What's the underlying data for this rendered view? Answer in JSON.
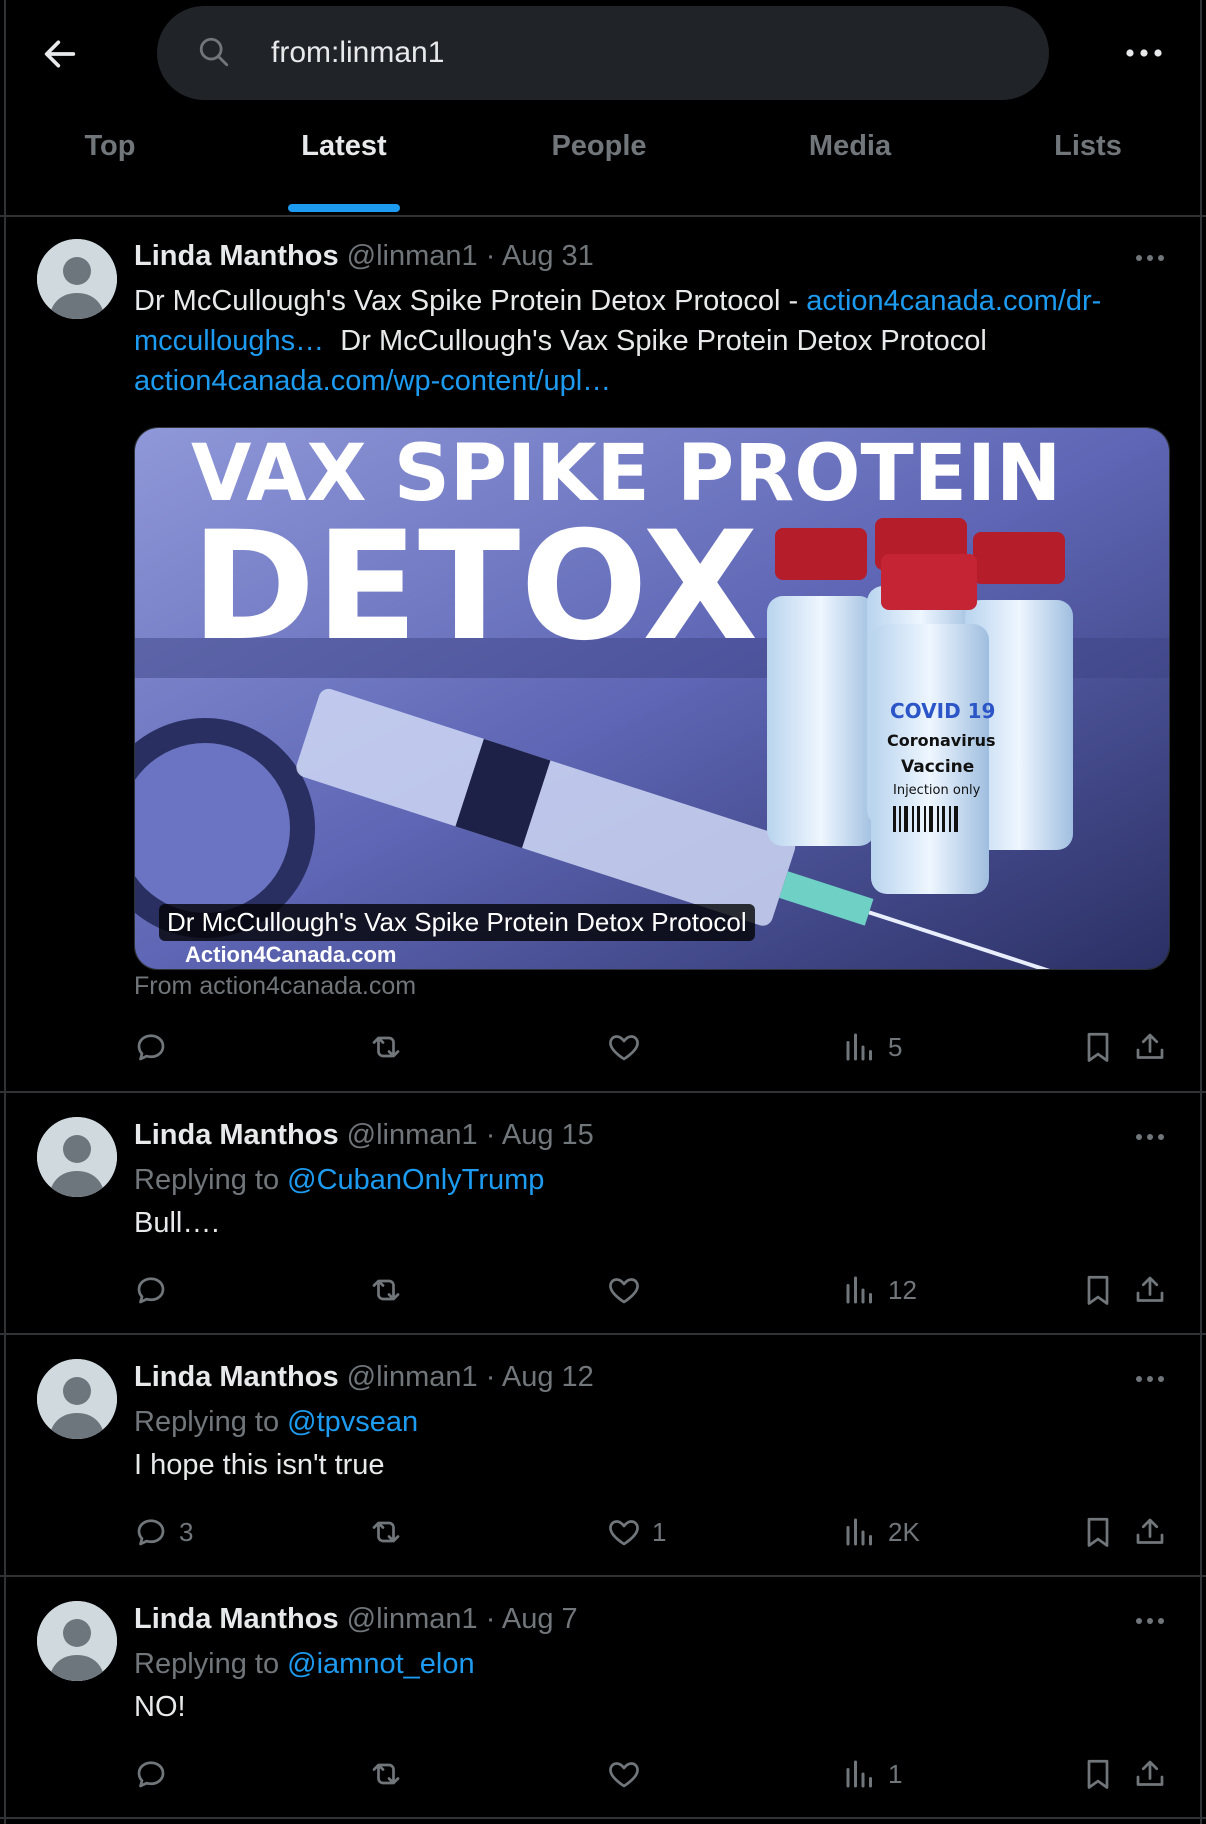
{
  "search": {
    "query": "from:linman1"
  },
  "tabs": [
    {
      "label": "Top",
      "active": false
    },
    {
      "label": "Latest",
      "active": true
    },
    {
      "label": "People",
      "active": false
    },
    {
      "label": "Media",
      "active": false
    },
    {
      "label": "Lists",
      "active": false
    }
  ],
  "colors": {
    "accent": "#1d9bf0",
    "background": "#000000",
    "muted": "#71767b",
    "text": "#e7e9ea"
  },
  "tweets": [
    {
      "name": "Linda Manthos",
      "handle": "@linman1",
      "separator": "·",
      "date": "Aug 31",
      "text_1": "Dr McCullough's Vax Spike Protein Detox Protocol - ",
      "link_1": "action4canada.com/dr-",
      "link_1b": "mcculloughs…",
      "text_2": "  Dr McCullough's Vax Spike Protein Detox Protocol",
      "link_2": "action4canada.com/wp-content/upl…",
      "card": {
        "headline_1": "VAX SPIKE PROTEIN",
        "headline_2": "DETOX",
        "vial_label_1": "COVID 19",
        "vial_label_2": "Coronavirus",
        "vial_label_3": "Vaccine",
        "vial_label_4": "Injection only",
        "caption": "Dr McCullough's Vax Spike Protein Detox Protocol",
        "brand": "Action4Canada.com",
        "from": "From action4canada.com"
      },
      "replies": "",
      "likes": "",
      "views": "5"
    },
    {
      "name": "Linda Manthos",
      "handle": "@linman1",
      "separator": "·",
      "date": "Aug 15",
      "replying_label": "Replying to",
      "replying_to": "@CubanOnlyTrump",
      "text": "Bull….",
      "replies": "",
      "likes": "",
      "views": "12"
    },
    {
      "name": "Linda Manthos",
      "handle": "@linman1",
      "separator": "·",
      "date": "Aug 12",
      "replying_label": "Replying to",
      "replying_to": "@tpvsean",
      "text": "I hope this isn't true",
      "replies": "3",
      "likes": "1",
      "views": "2K"
    },
    {
      "name": "Linda Manthos",
      "handle": "@linman1",
      "separator": "·",
      "date": "Aug 7",
      "replying_label": "Replying to",
      "replying_to": "@iamnot_elon",
      "text": "NO!",
      "replies": "",
      "likes": "",
      "views": "1"
    }
  ]
}
